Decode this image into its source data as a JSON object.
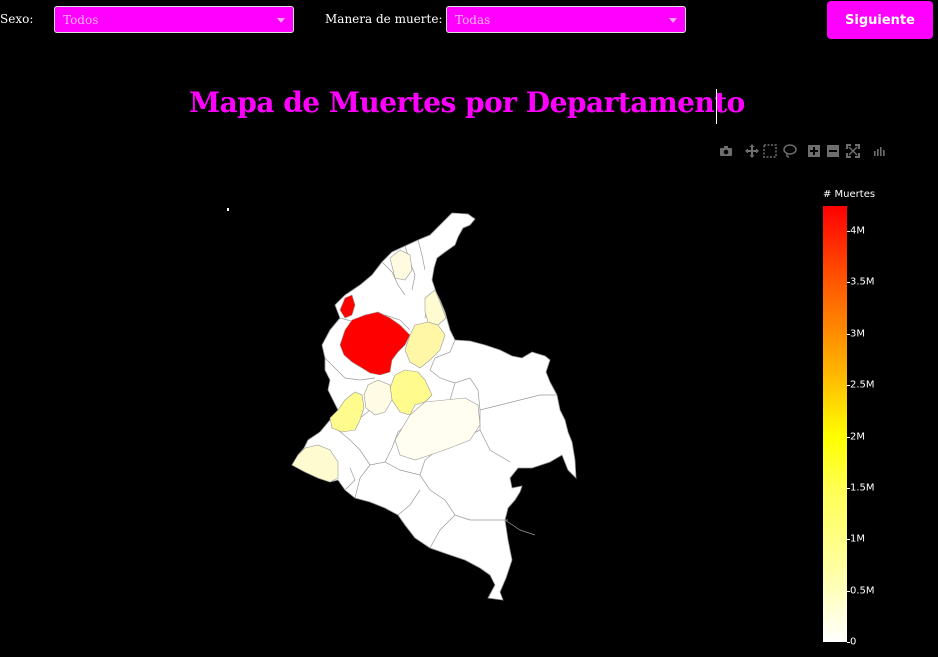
{
  "filters": {
    "sexo": {
      "label": "Sexo:",
      "value": "Todos"
    },
    "manera": {
      "label": "Manera de muerte:",
      "value": "Todas"
    }
  },
  "next_button": {
    "label": "Siguiente"
  },
  "title": "Mapa de Muertes por Departamento",
  "modebar": [
    "camera-icon",
    "pan-icon",
    "box-select-icon",
    "lasso-icon",
    "zoom-in-icon",
    "zoom-out-icon",
    "autoscale-icon",
    "plotly-logo-icon"
  ],
  "colorbar": {
    "title": "# Muertes",
    "ticks": [
      "4M",
      "3.5M",
      "3M",
      "2.5M",
      "2M",
      "1.5M",
      "1M",
      "0.5M",
      "0"
    ],
    "colors": [
      "#ffffff",
      "#ffffa0",
      "#ffff00",
      "#ff8c00",
      "#ff0000"
    ]
  },
  "colors": {
    "accent": "#ff00ff",
    "background": "#000000",
    "border": "#8c8c8c"
  }
}
